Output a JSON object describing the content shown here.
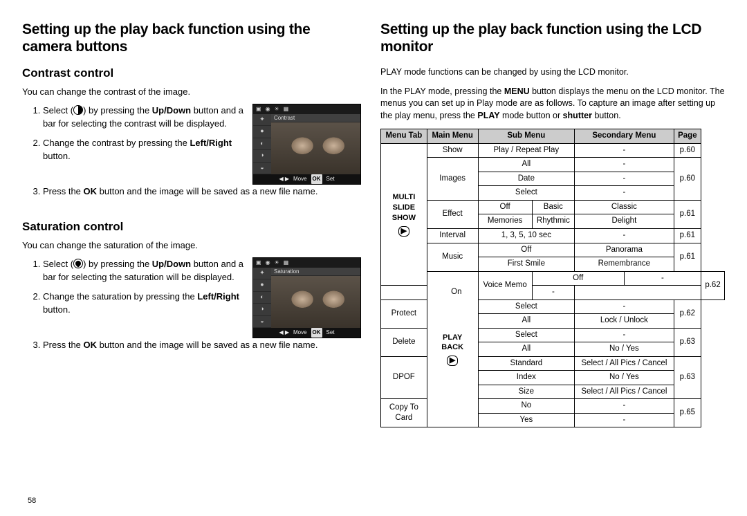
{
  "page_number": "58",
  "left": {
    "title": "Setting up the play back function using the camera buttons",
    "contrast": {
      "heading": "Contrast control",
      "intro": "You can change the contrast of the image.",
      "step1a": "Select (",
      "step1b": ") by pressing the ",
      "step1c": "Up/Down",
      "step1d": " button and a bar for selecting the contrast will be displayed.",
      "step2a": "Change the contrast by pressing the ",
      "step2b": "Left/Right",
      "step2c": " button.",
      "step3a": "Press the ",
      "step3b": "OK",
      "step3c": " button and the image will be saved as a new file name.",
      "thumb_label": "Contrast",
      "thumb_move": "Move",
      "thumb_ok": "OK",
      "thumb_set": "Set"
    },
    "saturation": {
      "heading": "Saturation control",
      "intro": "You can change the saturation of the image.",
      "step1a": "Select (",
      "step1b": ") by pressing the ",
      "step1c": "Up/Down",
      "step1d": " button and a bar for selecting the saturation will be displayed.",
      "step2a": "Change the saturation by pressing the ",
      "step2b": "Left/Right",
      "step2c": " button.",
      "step3a": "Press the ",
      "step3b": "OK",
      "step3c": " button and the image will be saved as a new file name.",
      "thumb_label": "Saturation",
      "thumb_move": "Move",
      "thumb_ok": "OK",
      "thumb_set": "Set"
    }
  },
  "right": {
    "title": "Setting up the play back function using the LCD monitor",
    "intro_1": "PLAY mode functions can be changed by using the LCD monitor.",
    "intro_2a": "In the PLAY mode, pressing the ",
    "intro_2b": "MENU",
    "intro_2c": " button displays the menu on the LCD monitor. The menus you can set up in Play mode are as follows. To capture an image after setting up the play menu, press the ",
    "intro_2d": "PLAY",
    "intro_2e": " mode button or ",
    "intro_2f": "shutter",
    "intro_2g": " button.",
    "headers": {
      "tab": "Menu Tab",
      "main": "Main Menu",
      "sub": "Sub Menu",
      "secondary": "Secondary Menu",
      "page": "Page"
    },
    "tabs": {
      "multi_line1": "MULTI",
      "multi_line2": "SLIDE",
      "multi_line3": "SHOW",
      "multi_icon": "▶",
      "play_line1": "PLAY",
      "play_line2": "BACK",
      "play_icon": "▶"
    },
    "rows": {
      "show": "Show",
      "play_repeat": "Play / Repeat Play",
      "all": "All",
      "images": "Images",
      "date": "Date",
      "select": "Select",
      "effect": "Effect",
      "off": "Off",
      "basic": "Basic",
      "classic": "Classic",
      "memories": "Memories",
      "rhythmic": "Rhythmic",
      "delight": "Delight",
      "interval": "Interval",
      "interval_vals": "1, 3, 5, 10 sec",
      "music": "Music",
      "panorama": "Panorama",
      "first_smile": "First Smile",
      "remembrance": "Remembrance",
      "voice_memo": "Voice Memo",
      "on": "On",
      "protect": "Protect",
      "lock_unlock": "Lock / Unlock",
      "delete": "Delete",
      "no_yes": "No / Yes",
      "dpof": "DPOF",
      "standard": "Standard",
      "index": "Index",
      "size": "Size",
      "select_all_cancel": "Select / All Pics / Cancel",
      "copy_to": "Copy To",
      "card": "Card",
      "no": "No",
      "yes": "Yes",
      "dash": "-",
      "p60": "p.60",
      "p61": "p.61",
      "p62": "p.62",
      "p63": "p.63",
      "p65": "p.65"
    }
  }
}
